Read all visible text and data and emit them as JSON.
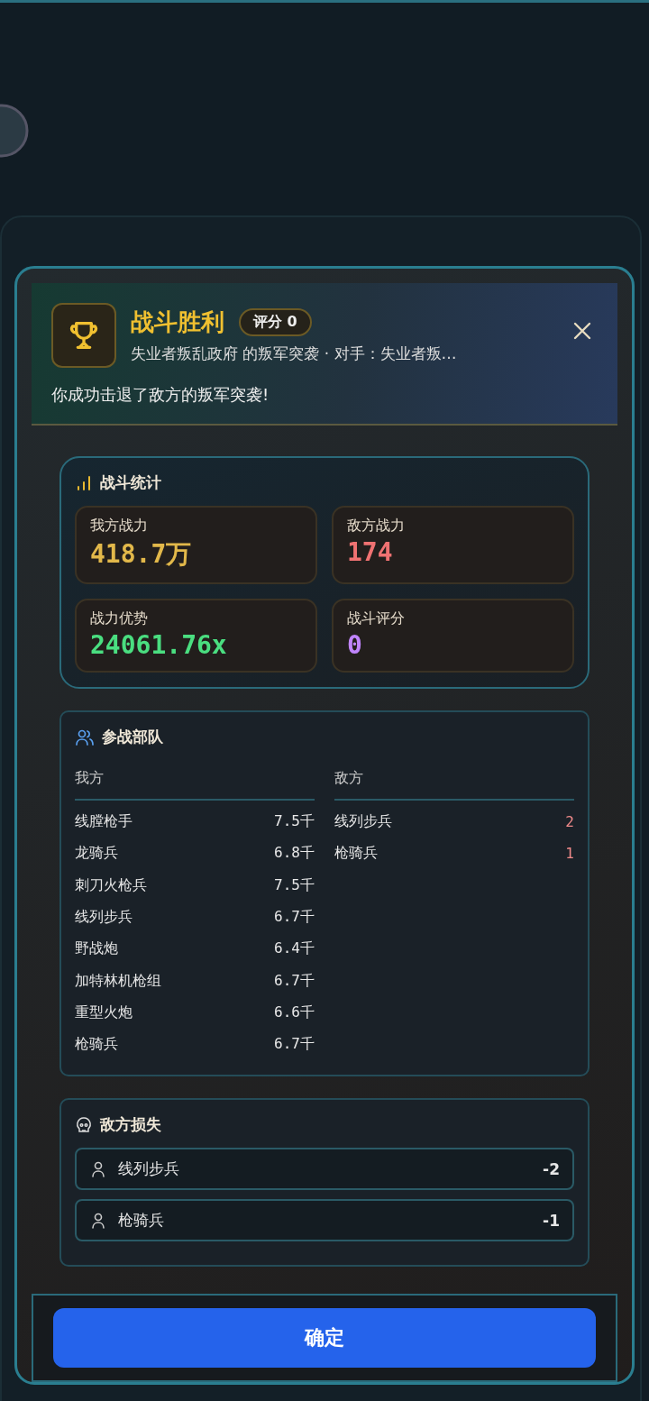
{
  "header": {
    "title": "战斗胜利",
    "score_badge": "评分 0",
    "subtitle": "失业者叛乱政府 的叛军突袭 · 对手：失业者叛…",
    "message": "你成功击退了敌方的叛军突袭!"
  },
  "stats": {
    "title": "战斗统计",
    "items": [
      {
        "label": "我方战力",
        "value": "418.7万",
        "color": "#e2b84a"
      },
      {
        "label": "敌方战力",
        "value": "174",
        "color": "#f07272"
      },
      {
        "label": "战力优势",
        "value": "24061.76x",
        "color": "#4ade80"
      },
      {
        "label": "战斗评分",
        "value": "0",
        "color": "#c084fc"
      }
    ]
  },
  "troops": {
    "title": "参战部队",
    "sides": [
      {
        "heading": "我方",
        "kind": "ally",
        "units": [
          {
            "name": "线膛枪手",
            "value": "7.5千"
          },
          {
            "name": "龙骑兵",
            "value": "6.8千"
          },
          {
            "name": "刺刀火枪兵",
            "value": "7.5千"
          },
          {
            "name": "线列步兵",
            "value": "6.7千"
          },
          {
            "name": "野战炮",
            "value": "6.4千"
          },
          {
            "name": "加特林机枪组",
            "value": "6.7千"
          },
          {
            "name": "重型火炮",
            "value": "6.6千"
          },
          {
            "name": "枪骑兵",
            "value": "6.7千"
          }
        ]
      },
      {
        "heading": "敌方",
        "kind": "enemy",
        "units": [
          {
            "name": "线列步兵",
            "value": "2"
          },
          {
            "name": "枪骑兵",
            "value": "1"
          }
        ]
      }
    ]
  },
  "losses": {
    "title": "敌方损失",
    "items": [
      {
        "name": "线列步兵",
        "value": "-2"
      },
      {
        "name": "枪骑兵",
        "value": "-1"
      }
    ]
  },
  "confirm_button": "确定"
}
